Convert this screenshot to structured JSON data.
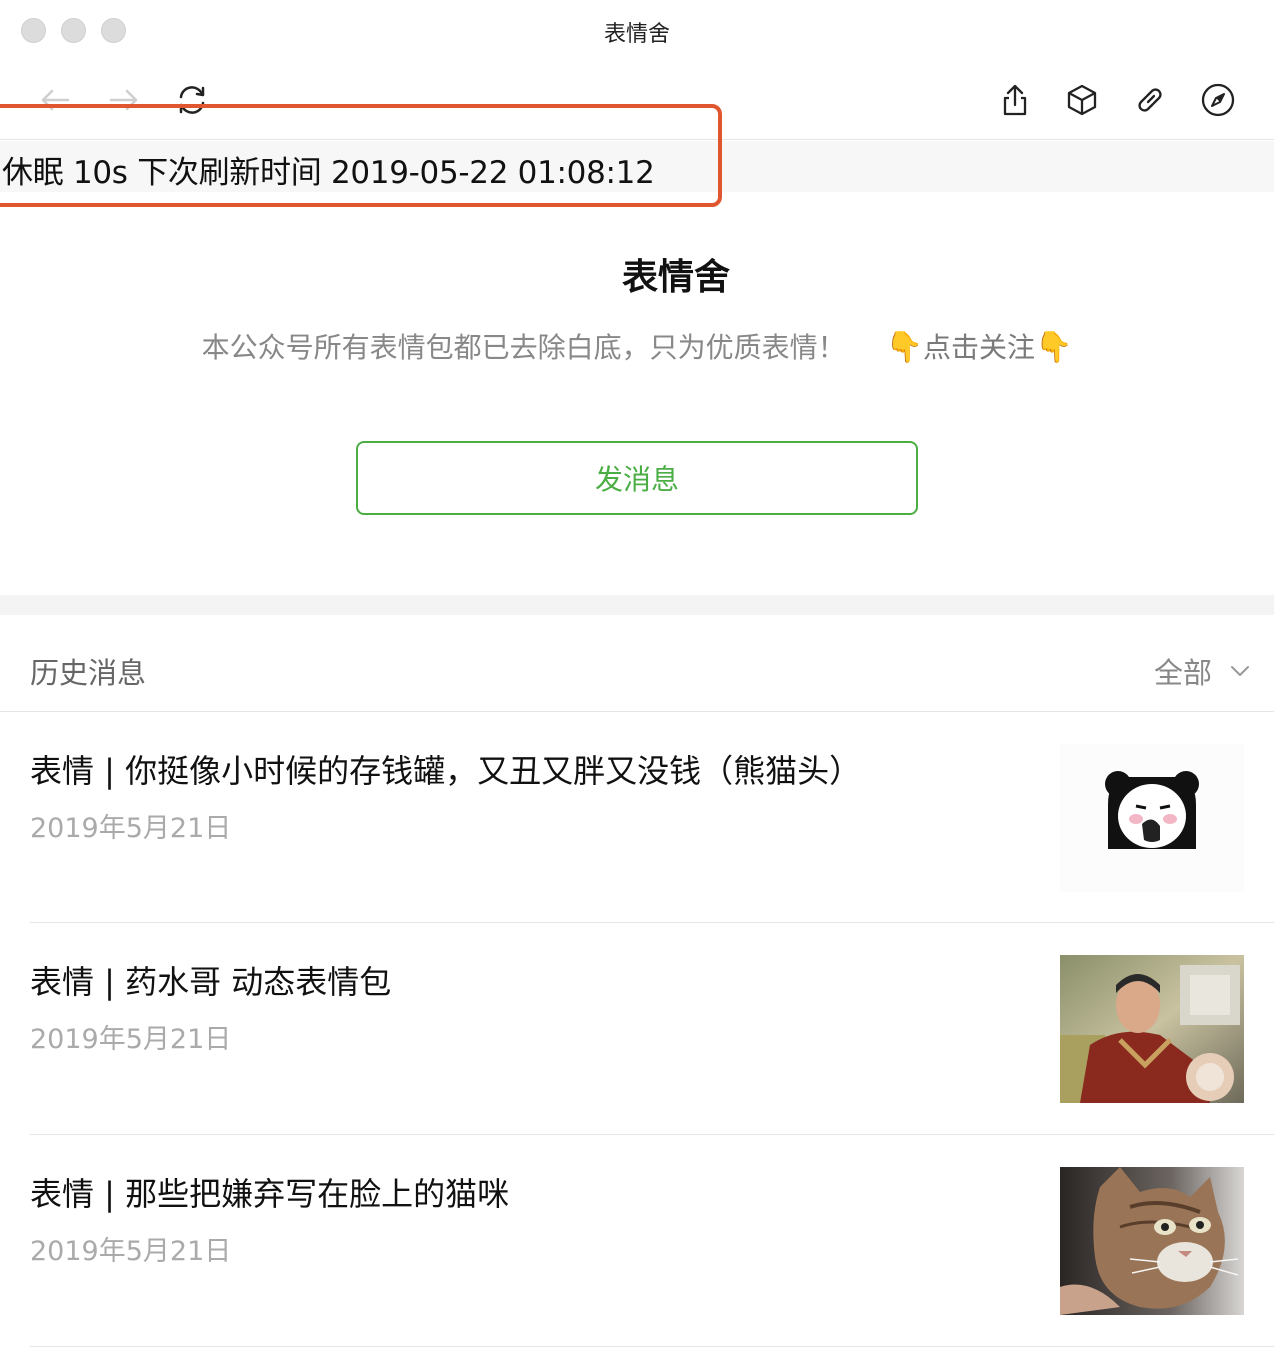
{
  "window": {
    "title": "表情舍"
  },
  "toolbar": {
    "back_icon": "arrow-left-icon",
    "forward_icon": "arrow-right-icon",
    "refresh_icon": "refresh-icon",
    "share_icon": "share-icon",
    "box_icon": "cube-icon",
    "link_icon": "link-icon",
    "compass_icon": "compass-icon"
  },
  "status": {
    "text": "休眠 10s 下次刷新时间 2019-05-22 01:08:12",
    "highlight_color": "#e0572f"
  },
  "profile": {
    "name": "表情舍",
    "description": "本公众号所有表情包都已去除白底，只为优质表情！",
    "follow_hand_left": "👇",
    "follow_label": "点击关注",
    "follow_hand_right": "👇",
    "send_button": "发消息",
    "accent_color": "#4bae45"
  },
  "history": {
    "title": "历史消息",
    "filter_label": "全部",
    "articles": [
      {
        "title": "表情 | 你挺像小时候的存钱罐，又丑又胖又没钱（熊猫头）",
        "date": "2019年5月21日",
        "thumbnail": "panda-meme-thumbnail"
      },
      {
        "title": "表情 | 药水哥 动态表情包",
        "date": "2019年5月21日",
        "thumbnail": "man-pointing-thumbnail"
      },
      {
        "title": "表情 | 那些把嫌弃写在脸上的猫咪",
        "date": "2019年5月21日",
        "thumbnail": "cat-thumbnail"
      }
    ]
  }
}
